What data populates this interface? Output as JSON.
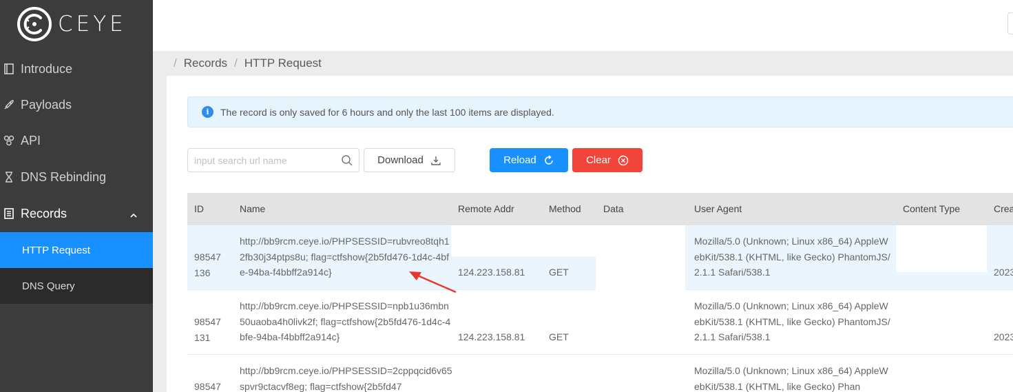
{
  "app": {
    "logo_text": "CEYE"
  },
  "sidebar": {
    "items": [
      {
        "label": "Introduce",
        "icon": "book-icon"
      },
      {
        "label": "Payloads",
        "icon": "rocket-icon"
      },
      {
        "label": "API",
        "icon": "api-icon"
      },
      {
        "label": "DNS Rebinding",
        "icon": "hourglass-icon"
      },
      {
        "label": "Records",
        "icon": "list-icon",
        "expanded": true
      }
    ],
    "sub_items": [
      {
        "label": "HTTP Request",
        "active": true
      },
      {
        "label": "DNS Query",
        "active": false
      }
    ]
  },
  "breadcrumb": {
    "items": [
      "Records",
      "HTTP Request"
    ]
  },
  "alert": {
    "text": "The record is only saved for 6 hours and only the last 100 items are displayed."
  },
  "toolbar": {
    "search_placeholder": "input search url name",
    "download_label": "Download",
    "reload_label": "Reload",
    "clear_label": "Clear"
  },
  "table": {
    "columns": [
      "ID",
      "Name",
      "Remote Addr",
      "Method",
      "Data",
      "User Agent",
      "Content Type",
      "Crea"
    ],
    "rows": [
      {
        "id_1": "98547",
        "id_2": "136",
        "name": "http://bb9rcm.ceye.io/PHPSESSID=rubvreo8tqh12fb30j34ptps8u; flag=ctfshow{2b5fd476-1d4c-4bfe-94ba-f4bbff2a914c}",
        "remote_addr": "124.223.158.81",
        "method": "GET",
        "data": "",
        "user_agent": "Mozilla/5.0 (Unknown; Linux x86_64) AppleWebKit/538.1 (KHTML, like Gecko) PhantomJS/2.1.1 Safari/538.1",
        "content_type": "",
        "created": "2023"
      },
      {
        "id_1": "98547",
        "id_2": "131",
        "name": "http://bb9rcm.ceye.io/PHPSESSID=npb1u36mbn50uaoba4h0livk2f; flag=ctfshow{2b5fd476-1d4c-4bfe-94ba-f4bbff2a914c}",
        "remote_addr": "124.223.158.81",
        "method": "GET",
        "data": "",
        "user_agent": "Mozilla/5.0 (Unknown; Linux x86_64) AppleWebKit/538.1 (KHTML, like Gecko) PhantomJS/2.1.1 Safari/538.1",
        "content_type": "",
        "created": "2023"
      },
      {
        "id_1": "98547",
        "id_2": "",
        "name": "http://bb9rcm.ceye.io/PHPSESSID=2cppqcid6v65spvr9ctacvf8eg; flag=ctfshow{2b5fd47",
        "remote_addr": "",
        "method": "",
        "data": "",
        "user_agent": "Mozilla/5.0 (Unknown; Linux x86_64) AppleWebKit/538.1 (KHTML, like Gecko) Phan",
        "content_type": "",
        "created": ""
      }
    ]
  },
  "colors": {
    "sidebar_bg": "#3c3c3c",
    "accent": "#1890ff",
    "danger": "#f0453a",
    "highlight_row": "#ebf5fe"
  }
}
